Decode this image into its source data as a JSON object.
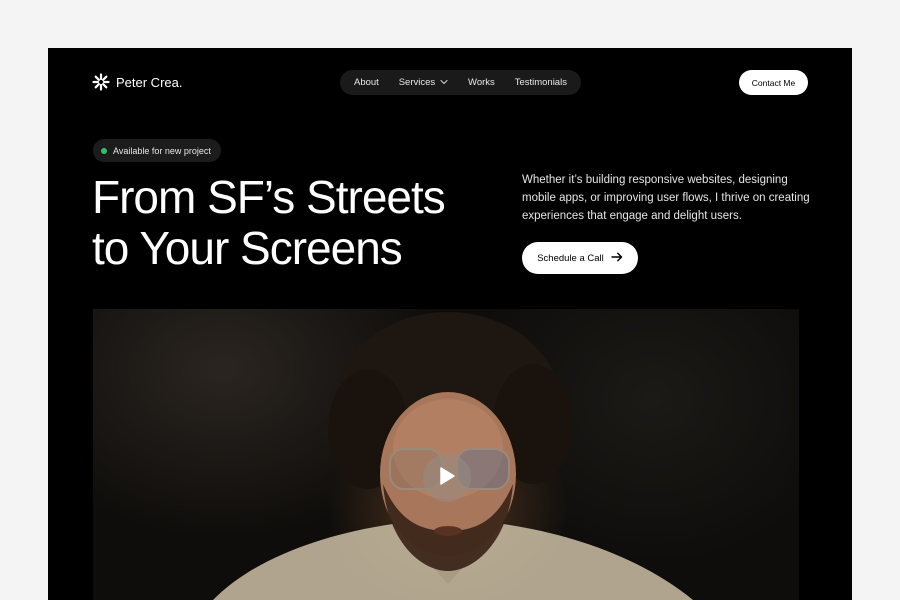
{
  "brand": {
    "name": "Peter Crea.",
    "logo_icon": "starburst-icon"
  },
  "nav": {
    "items": [
      {
        "label": "About"
      },
      {
        "label": "Services",
        "has_dropdown": true
      },
      {
        "label": "Works"
      },
      {
        "label": "Testimonials"
      }
    ]
  },
  "header": {
    "contact_label": "Contact Me"
  },
  "hero": {
    "badge": "Available for new project",
    "badge_color": "#2ec26a",
    "headline_line1": "From SF’s Streets",
    "headline_line2": "to Your Screens",
    "description": "Whether it’s building responsive websites, designing mobile apps, or improving user flows, I thrive on creating experiences that engage and delight users.",
    "cta_label": "Schedule a Call"
  },
  "video": {
    "play_icon": "play-icon"
  }
}
